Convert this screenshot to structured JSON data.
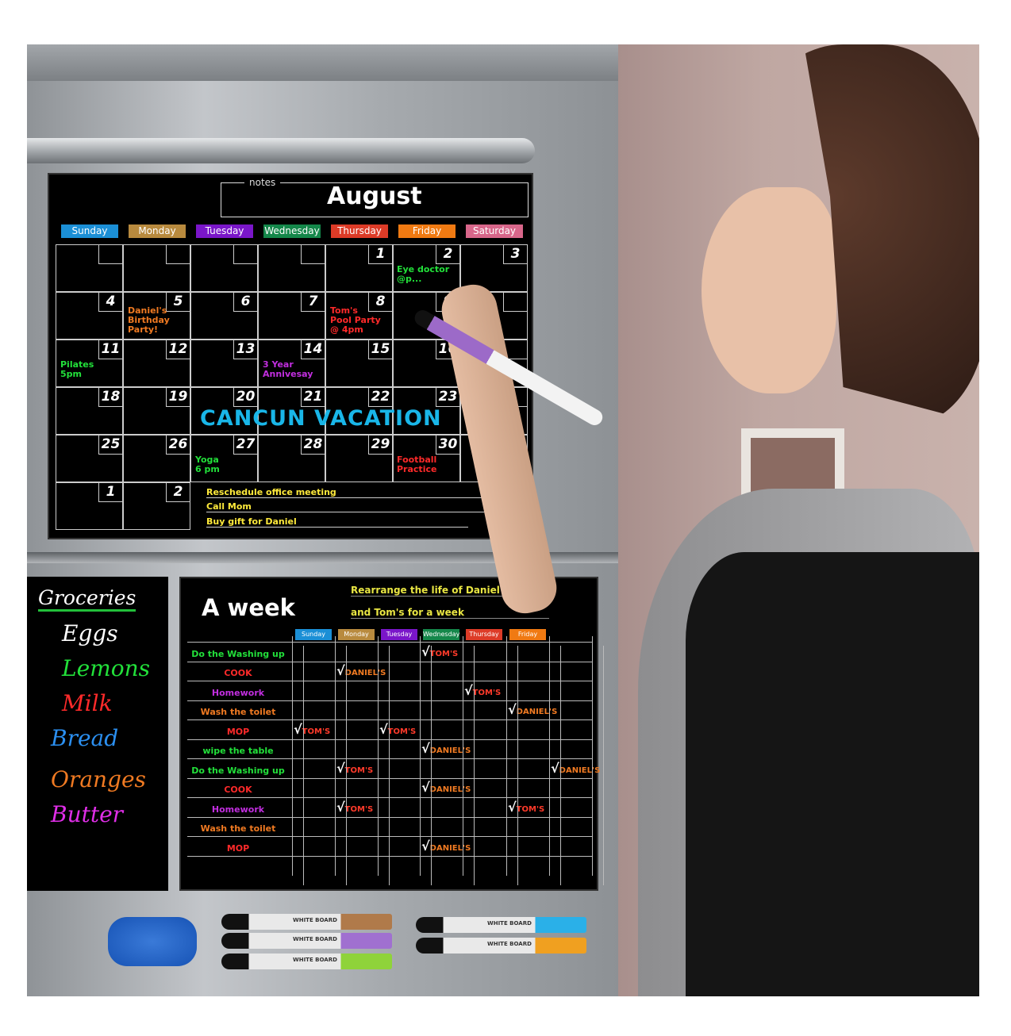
{
  "calendar": {
    "notes_label": "notes",
    "month": "August",
    "days": [
      {
        "label": "Sunday",
        "color": "#1b8fd6"
      },
      {
        "label": "Monday",
        "color": "#b88a3e"
      },
      {
        "label": "Tuesday",
        "color": "#7a16c9"
      },
      {
        "label": "Wednesday",
        "color": "#14874a"
      },
      {
        "label": "Thursday",
        "color": "#dd3b27"
      },
      {
        "label": "Friday",
        "color": "#f07a12"
      },
      {
        "label": "Saturday",
        "color": "#d8668a"
      }
    ],
    "weeks": [
      [
        "",
        "",
        "",
        "",
        "1",
        "2",
        "3"
      ],
      [
        "4",
        "5",
        "6",
        "7",
        "8",
        "9",
        ""
      ],
      [
        "11",
        "12",
        "13",
        "14",
        "15",
        "16",
        ""
      ],
      [
        "18",
        "19",
        "20",
        "21",
        "22",
        "23",
        ""
      ],
      [
        "25",
        "26",
        "27",
        "28",
        "29",
        "30",
        ""
      ],
      [
        "1",
        "2"
      ]
    ],
    "notes": [
      {
        "text": "Eye doctor\n@p...",
        "color": "#22e03a",
        "week": 0,
        "day": 5
      },
      {
        "text": "Daniel's\nBirthday\nParty!",
        "color": "#f07a22",
        "week": 1,
        "day": 1
      },
      {
        "text": "Tom's\nPool Party\n@ 4pm",
        "color": "#ff2a2a",
        "week": 1,
        "day": 4
      },
      {
        "text": "Pilates\n5pm",
        "color": "#22e03a",
        "week": 2,
        "day": 0
      },
      {
        "text": "3 Year\nAnnivesay",
        "color": "#c22ee0",
        "week": 2,
        "day": 3
      },
      {
        "text": "Yoga\n6 pm",
        "color": "#22e03a",
        "week": 4,
        "day": 2
      },
      {
        "text": "Football\nPractice",
        "color": "#ff2a2a",
        "week": 4,
        "day": 5
      }
    ],
    "banner": "CANCUN VACATION",
    "todos": [
      "Reschedule office meeting",
      "Call Mom",
      "Buy gift for Daniel"
    ]
  },
  "groceries": {
    "title": "Groceries",
    "items": [
      {
        "text": "Eggs",
        "color": "#ffffff"
      },
      {
        "text": "Lemons",
        "color": "#22e03a"
      },
      {
        "text": "Milk",
        "color": "#ff2a2a"
      },
      {
        "text": "Bread",
        "color": "#2b8ff0"
      },
      {
        "text": "Oranges",
        "color": "#f07a22"
      },
      {
        "text": "Butter",
        "color": "#e02ee8"
      }
    ]
  },
  "week": {
    "title": "A week",
    "subtitle1": "Rearrange the life of Daniel",
    "subtitle2": "and Tom's for a week",
    "days": [
      {
        "label": "Sunday",
        "color": "#1b8fd6"
      },
      {
        "label": "Monday",
        "color": "#b88a3e"
      },
      {
        "label": "Tuesday",
        "color": "#7a16c9"
      },
      {
        "label": "Wednesday",
        "color": "#14874a"
      },
      {
        "label": "Thursday",
        "color": "#dd3b27"
      },
      {
        "label": "Friday",
        "color": "#f07a12"
      }
    ],
    "tasks": [
      {
        "label": "Do the Washing up",
        "color": "#22e03a",
        "checks": [
          {
            "day": 3,
            "who": "TOM'S"
          }
        ]
      },
      {
        "label": "COOK",
        "color": "#ff2a2a",
        "checks": [
          {
            "day": 1,
            "who": "DANIEL'S"
          }
        ]
      },
      {
        "label": "Homework",
        "color": "#c22ee0",
        "checks": [
          {
            "day": 4,
            "who": "TOM'S"
          }
        ]
      },
      {
        "label": "Wash the toilet",
        "color": "#f07a22",
        "checks": [
          {
            "day": 5,
            "who": "DANIEL'S"
          }
        ]
      },
      {
        "label": "MOP",
        "color": "#ff2a2a",
        "checks": [
          {
            "day": 0,
            "who": "TOM'S"
          },
          {
            "day": 2,
            "who": "TOM'S"
          }
        ]
      },
      {
        "label": "wipe the table",
        "color": "#22e03a",
        "checks": [
          {
            "day": 3,
            "who": "DANIEL'S"
          }
        ]
      },
      {
        "label": "Do the Washing up",
        "color": "#22e03a",
        "checks": [
          {
            "day": 1,
            "who": "TOM'S"
          },
          {
            "day": 6,
            "who": "DANIEL'S"
          }
        ]
      },
      {
        "label": "COOK",
        "color": "#ff2a2a",
        "checks": [
          {
            "day": 3,
            "who": "DANIEL'S"
          }
        ]
      },
      {
        "label": "Homework",
        "color": "#c22ee0",
        "checks": [
          {
            "day": 1,
            "who": "TOM'S"
          },
          {
            "day": 5,
            "who": "TOM'S"
          }
        ]
      },
      {
        "label": "Wash the toilet",
        "color": "#f07a22",
        "checks": []
      },
      {
        "label": "MOP",
        "color": "#ff2a2a",
        "checks": [
          {
            "day": 3,
            "who": "DANIEL'S"
          }
        ]
      }
    ],
    "check_mark": "√"
  },
  "markers": {
    "label": "WHITE BOARD",
    "colors": [
      "#b07a4a",
      "#a070d0",
      "#8fd33a",
      "#2ab0e8",
      "#f0a020"
    ]
  }
}
